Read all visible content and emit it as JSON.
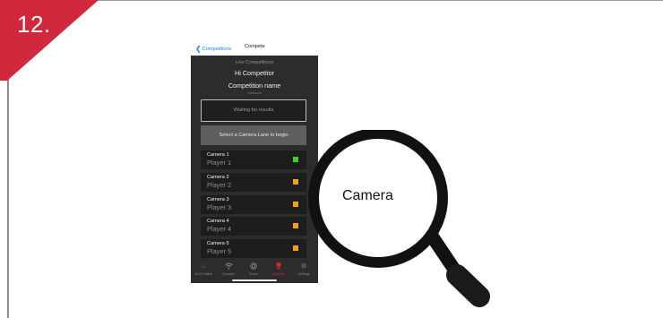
{
  "step": {
    "number": "12.",
    "accent_color": "#d0283c"
  },
  "nav": {
    "back_label": "Competitions",
    "title": "Compete"
  },
  "header": {
    "live_label": "Live Competitions",
    "greeting": "Hi Competitor",
    "competition_name": "Competition name",
    "sub_label": "Distance"
  },
  "status": {
    "waiting_text": "Waiting for results"
  },
  "select_button": {
    "label": "Select a Camera Lane to begin"
  },
  "cameras": [
    {
      "name": "Camera 1",
      "player": "Player 1",
      "status_color": "#3fd12f"
    },
    {
      "name": "Camera 2",
      "player": "Player 2",
      "status_color": "#f3a11b"
    },
    {
      "name": "Camera 3",
      "player": "Player 3",
      "status_color": "#f3a11b"
    },
    {
      "name": "Camera 4",
      "player": "Player 4",
      "status_color": "#f3a11b"
    },
    {
      "name": "Camera 5",
      "player": "Player 5",
      "status_color": "#f3a11b"
    }
  ],
  "tabs": [
    {
      "label": "SLXY Hitbot",
      "icon": "home-icon"
    },
    {
      "label": "Connect",
      "icon": "wifi-icon"
    },
    {
      "label": "Score",
      "icon": "target-icon"
    },
    {
      "label": "Compete",
      "icon": "trophy-icon",
      "active": true
    },
    {
      "label": "Settings",
      "icon": "gear-icon"
    }
  ],
  "magnifier": {
    "label": "Camera"
  }
}
